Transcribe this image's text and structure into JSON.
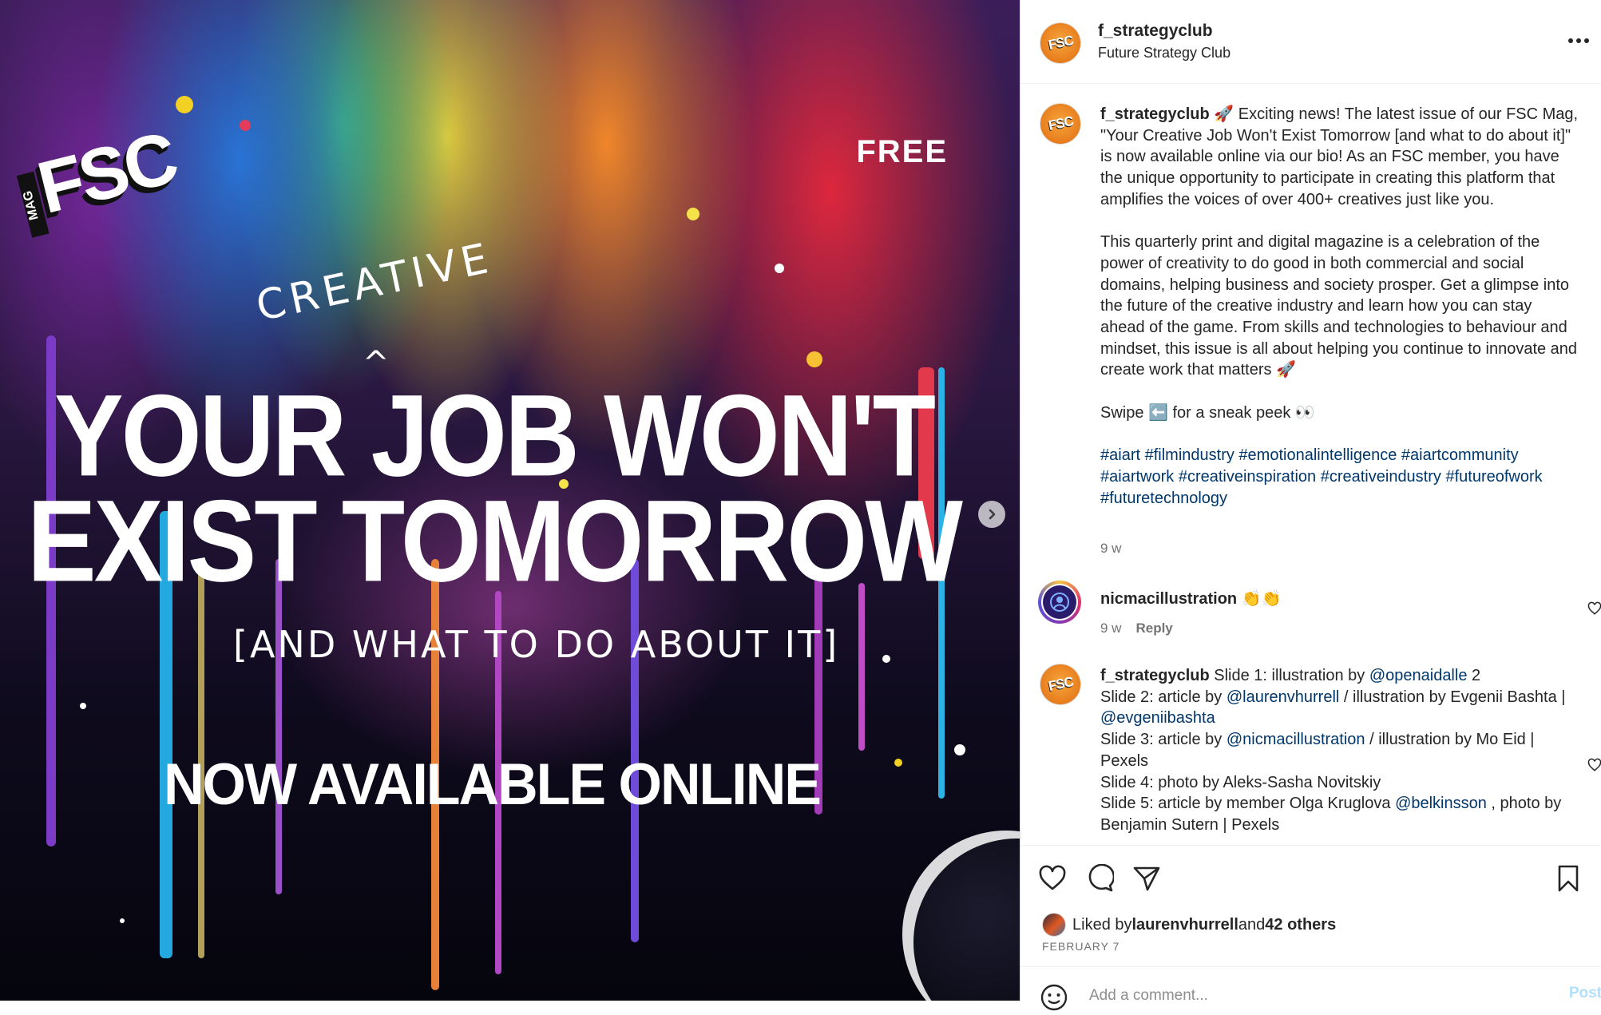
{
  "media": {
    "logo_text": "FSC",
    "logo_tag": "MAG",
    "free_label": "FREE",
    "creative_word": "CREATIVE",
    "caret": "^",
    "headline_line1": "YOUR JOB WON'T",
    "headline_line2": "EXIST TOMORROW",
    "subline": "[AND WHAT TO DO ABOUT IT]",
    "available": "NOW AVAILABLE ONLINE"
  },
  "header": {
    "avatar_text": "FSC",
    "username": "f_strategyclub",
    "subtitle": "Future Strategy Club"
  },
  "caption": {
    "username": "f_strategyclub",
    "para1": " 🚀 Exciting news! The latest issue of our FSC Mag, \"Your Creative Job Won't Exist Tomorrow [and what to do about it]\" is now available online via our bio! As an FSC member, you have the unique opportunity to participate in creating this platform that amplifies the voices of over 400+ creatives just like you.",
    "para2": "This quarterly print and digital magazine is a celebration of the power of creativity to do good in both commercial and social domains, helping business and society prosper. Get a glimpse into the future of the creative industry and learn how you can stay ahead of the game. From skills and technologies to behaviour and mindset, this issue is all about helping you continue to innovate and create work that matters 🚀",
    "para3": "Swipe ⬅️ for a sneak peek 👀",
    "hashtags": [
      "#aiart",
      "#filmindustry",
      "#emotionalintelligence",
      "#aiartcommunity",
      "#aiartwork",
      "#creativeinspiration",
      "#creativeindustry",
      "#futureofwork",
      "#futuretechnology"
    ],
    "time": "9 w"
  },
  "comment1": {
    "username": "nicmacillustration",
    "text": " 👏👏",
    "time": "9 w",
    "reply": "Reply"
  },
  "comment2": {
    "username": "f_strategyclub",
    "l1a": " Slide 1: illustration by ",
    "m1": "@openaidalle",
    "l1b": " 2",
    "l2a": "Slide 2: article by ",
    "m2": "@laurenvhurrell",
    "l2b": " / illustration by Evgenii Bashta | ",
    "m3": "@evgeniibashta",
    "l3a": "Slide 3: article by ",
    "m4": "@nicmacillustration",
    "l3b": " / illustration by Mo Eid | Pexels",
    "l4": "Slide 4: photo by Aleks-Sasha Novitskiy",
    "l5a": "Slide 5: article by member Olga Kruglova ",
    "m5": "@belkinsson",
    "l5b": " , photo by Benjamin Sutern | Pexels"
  },
  "likes": {
    "prefix": "Liked by ",
    "user": "laurenvhurrell",
    "middle": " and ",
    "others": "42 others"
  },
  "date": "FEBRUARY 7",
  "add_comment": {
    "placeholder": "Add a comment...",
    "post_label": "Post"
  },
  "icons": {
    "more": "more-horizontal-icon",
    "like": "heart-icon",
    "comment": "comment-bubble-icon",
    "share": "paper-plane-icon",
    "save": "bookmark-icon",
    "emoji": "smiley-icon",
    "next": "chevron-right-icon"
  },
  "colors": {
    "link": "#00376b",
    "muted": "#737373",
    "post_button": "#b2dffc",
    "avatar_orange": "#e77d1d"
  }
}
